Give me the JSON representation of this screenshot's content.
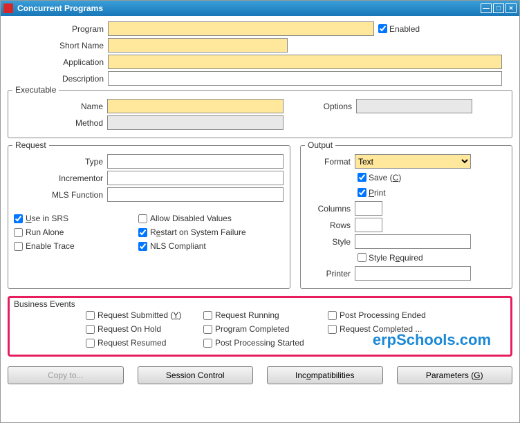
{
  "window": {
    "title": "Concurrent Programs"
  },
  "header": {
    "program_label": "Program",
    "enabled_label": "Enabled",
    "enabled_checked": true,
    "short_name_label": "Short Name",
    "application_label": "Application",
    "description_label": "Description"
  },
  "executable": {
    "legend": "Executable",
    "name_label": "Name",
    "method_label": "Method",
    "options_label": "Options"
  },
  "request": {
    "legend": "Request",
    "type_label": "Type",
    "incrementor_label": "Incrementor",
    "mls_label": "MLS Function",
    "use_in_srs": "Use in SRS",
    "use_in_srs_checked": true,
    "run_alone": "Run Alone",
    "enable_trace": "Enable Trace",
    "allow_disabled": "Allow Disabled Values",
    "restart": "Restart on System Failure",
    "restart_checked": true,
    "nls": "NLS Compliant",
    "nls_checked": true
  },
  "output": {
    "legend": "Output",
    "format_label": "Format",
    "format_value": "Text",
    "save_label": "Save (C)",
    "save_checked": true,
    "print_label": "Print",
    "print_checked": true,
    "columns_label": "Columns",
    "rows_label": "Rows",
    "style_label": "Style",
    "style_required": "Style Required",
    "printer_label": "Printer"
  },
  "business_events": {
    "legend": "Business Events",
    "items": {
      "req_submitted": "Request Submitted (Y)",
      "req_running": "Request Running",
      "post_ended": "Post Processing Ended",
      "req_on_hold": "Request On Hold",
      "prog_completed": "Program Completed",
      "req_completed": "Request Completed ...",
      "req_resumed": "Request Resumed",
      "post_started": "Post Processing Started"
    }
  },
  "buttons": {
    "copy": "Copy to...",
    "session": "Session Control",
    "incompat": "Incompatibilities",
    "params": "Parameters (G)"
  },
  "watermark": "erpSchools.com"
}
